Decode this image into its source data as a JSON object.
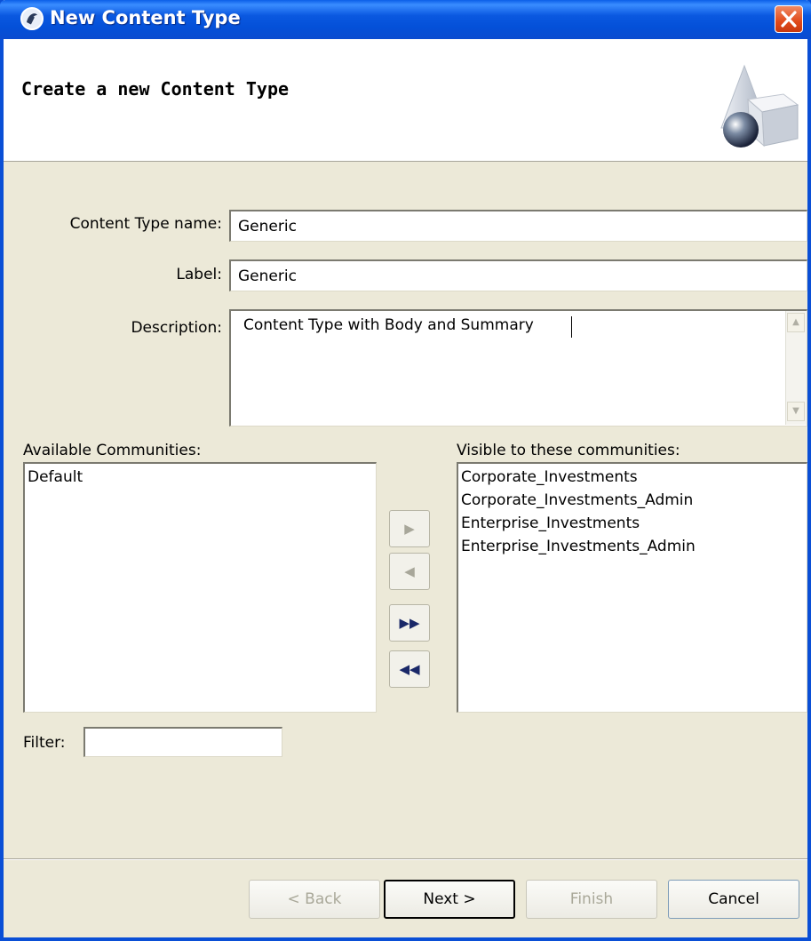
{
  "window": {
    "title": "New Content Type"
  },
  "banner": {
    "title": "Create a new Content Type"
  },
  "form": {
    "name_label": "Content Type name:",
    "name_value": "Generic",
    "label_label": "Label:",
    "label_value": "Generic",
    "description_label": "Description:",
    "description_value": "Content Type with Body and Summary"
  },
  "available": {
    "header": "Available Communities:",
    "items": [
      "Default"
    ]
  },
  "visible": {
    "header": "Visible to these communities:",
    "items": [
      "Corporate_Investments",
      "Corporate_Investments_Admin",
      "Enterprise_Investments",
      "Enterprise_Investments_Admin"
    ]
  },
  "move_buttons": {
    "add": "▶",
    "remove": "◀",
    "add_all": "▶▶",
    "remove_all": "◀◀"
  },
  "filter": {
    "label": "Filter:",
    "value": ""
  },
  "footer": {
    "back": "< Back",
    "next": "Next >",
    "finish": "Finish",
    "cancel": "Cancel"
  },
  "colors": {
    "titlebar": "#0a58e0",
    "dialog_bg": "#ece9d8",
    "close": "#e04a1a"
  }
}
